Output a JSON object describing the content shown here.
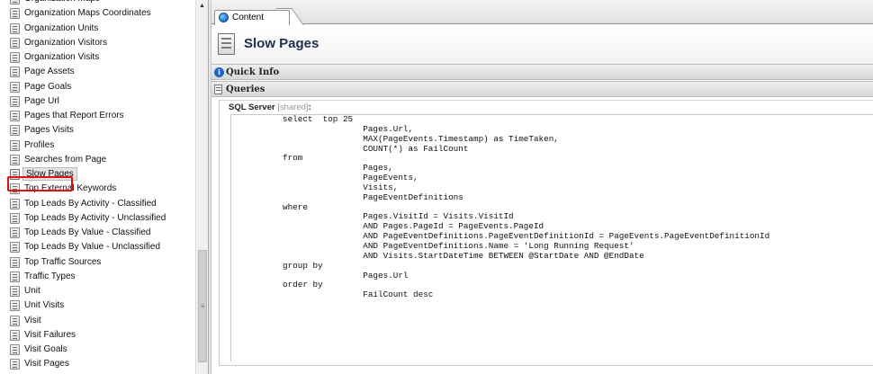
{
  "tree": {
    "items": [
      {
        "label": "Organization Maps",
        "selected": false
      },
      {
        "label": "Organization Maps Coordinates",
        "selected": false
      },
      {
        "label": "Organization Units",
        "selected": false
      },
      {
        "label": "Organization Visitors",
        "selected": false
      },
      {
        "label": "Organization Visits",
        "selected": false
      },
      {
        "label": "Page Assets",
        "selected": false
      },
      {
        "label": "Page Goals",
        "selected": false
      },
      {
        "label": "Page Url",
        "selected": false
      },
      {
        "label": "Pages that Report Errors",
        "selected": false
      },
      {
        "label": "Pages Visits",
        "selected": false
      },
      {
        "label": "Profiles",
        "selected": false
      },
      {
        "label": "Searches from Page",
        "selected": false
      },
      {
        "label": "Slow Pages",
        "selected": true
      },
      {
        "label": "Top External Keywords",
        "selected": false
      },
      {
        "label": "Top Leads By Activity - Classified",
        "selected": false
      },
      {
        "label": "Top Leads By Activity - Unclassified",
        "selected": false
      },
      {
        "label": "Top Leads By Value - Classified",
        "selected": false
      },
      {
        "label": "Top Leads By Value - Unclassified",
        "selected": false
      },
      {
        "label": "Top Traffic Sources",
        "selected": false
      },
      {
        "label": "Traffic Types",
        "selected": false
      },
      {
        "label": "Unit",
        "selected": false
      },
      {
        "label": "Unit Visits",
        "selected": false
      },
      {
        "label": "Visit",
        "selected": false
      },
      {
        "label": "Visit Failures",
        "selected": false
      },
      {
        "label": "Visit Goals",
        "selected": false
      },
      {
        "label": "Visit Pages",
        "selected": false
      }
    ]
  },
  "tabs": {
    "content_label": "Content"
  },
  "header": {
    "title": "Slow Pages"
  },
  "sections": {
    "quick_info": "Quick Info",
    "queries": "Queries"
  },
  "query": {
    "label": "SQL Server",
    "shared": "[shared]",
    "label_suffix": ":",
    "code": "select  top 25\n                Pages.Url,\n                MAX(PageEvents.Timestamp) as TimeTaken,\n                COUNT(*) as FailCount\nfrom\n                Pages,\n                PageEvents,\n                Visits,\n                PageEventDefinitions\nwhere\n                Pages.VisitId = Visits.VisitId\n                AND Pages.PageId = PageEvents.PageId\n                AND PageEventDefinitions.PageEventDefinitionId = PageEvents.PageEventDefinitionId\n                AND PageEventDefinitions.Name = 'Long Running Request'\n                AND Visits.StartDateTime BETWEEN @StartDate AND @EndDate\ngroup by\n                Pages.Url\norder by\n                FailCount desc"
  },
  "colors": {
    "highlight": "#e01010",
    "title": "#1f2d4f"
  }
}
